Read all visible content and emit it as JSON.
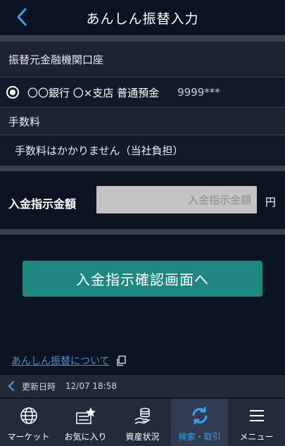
{
  "header": {
    "title": "あんしん振替入力"
  },
  "source_account": {
    "section_label": "振替元金融機関口座",
    "account_text": "〇〇銀行 〇×支店 普通預金",
    "account_number": "9999***"
  },
  "fee": {
    "section_label": "手数料",
    "description": "手数料はかかりません（当社負担）"
  },
  "amount": {
    "label": "入金指示金額",
    "placeholder": "入金指示金額",
    "value": "",
    "unit": "円"
  },
  "confirm_button": {
    "label": "入金指示確認画面へ"
  },
  "about_link": {
    "label": "あんしん振替について"
  },
  "update": {
    "label": "更新日時",
    "time": "12/07 18:58"
  },
  "tabbar": {
    "accent": "#35a3ef",
    "items": [
      {
        "label": "マーケット",
        "icon": "globe-icon"
      },
      {
        "label": "お気に入り",
        "icon": "favorites-icon"
      },
      {
        "label": "資産状況",
        "icon": "coins-icon"
      },
      {
        "label": "検索・取引",
        "icon": "trade-arrows-icon",
        "active": true
      },
      {
        "label": "メニュー",
        "icon": "menu-icon"
      }
    ]
  }
}
